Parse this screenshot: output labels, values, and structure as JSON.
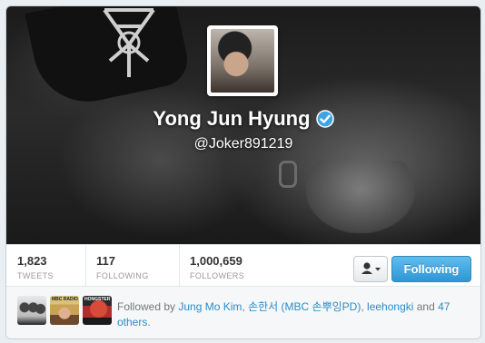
{
  "profile": {
    "name": "Yong Jun Hyung",
    "handle": "@Joker891219",
    "verified_icon": "verified-badge-icon",
    "accent_color": "#2f96d4"
  },
  "stats": [
    {
      "value": "1,823",
      "label": "TWEETS"
    },
    {
      "value": "117",
      "label": "FOLLOWING"
    },
    {
      "value": "1,000,659",
      "label": "FOLLOWERS"
    }
  ],
  "actions": {
    "user_menu_icon": "person-icon",
    "follow_label": "Following"
  },
  "followed_by": {
    "prefix": "Followed by",
    "users": [
      "Jung Mo Kim",
      "손한서 (MBC 손뿌잉PD)",
      "leehongki"
    ],
    "and_text": "and",
    "others": "47 others",
    "sep": ",",
    "end": ".",
    "avatar_labels": [
      "MBC RADIO",
      "HONGSTER"
    ]
  }
}
